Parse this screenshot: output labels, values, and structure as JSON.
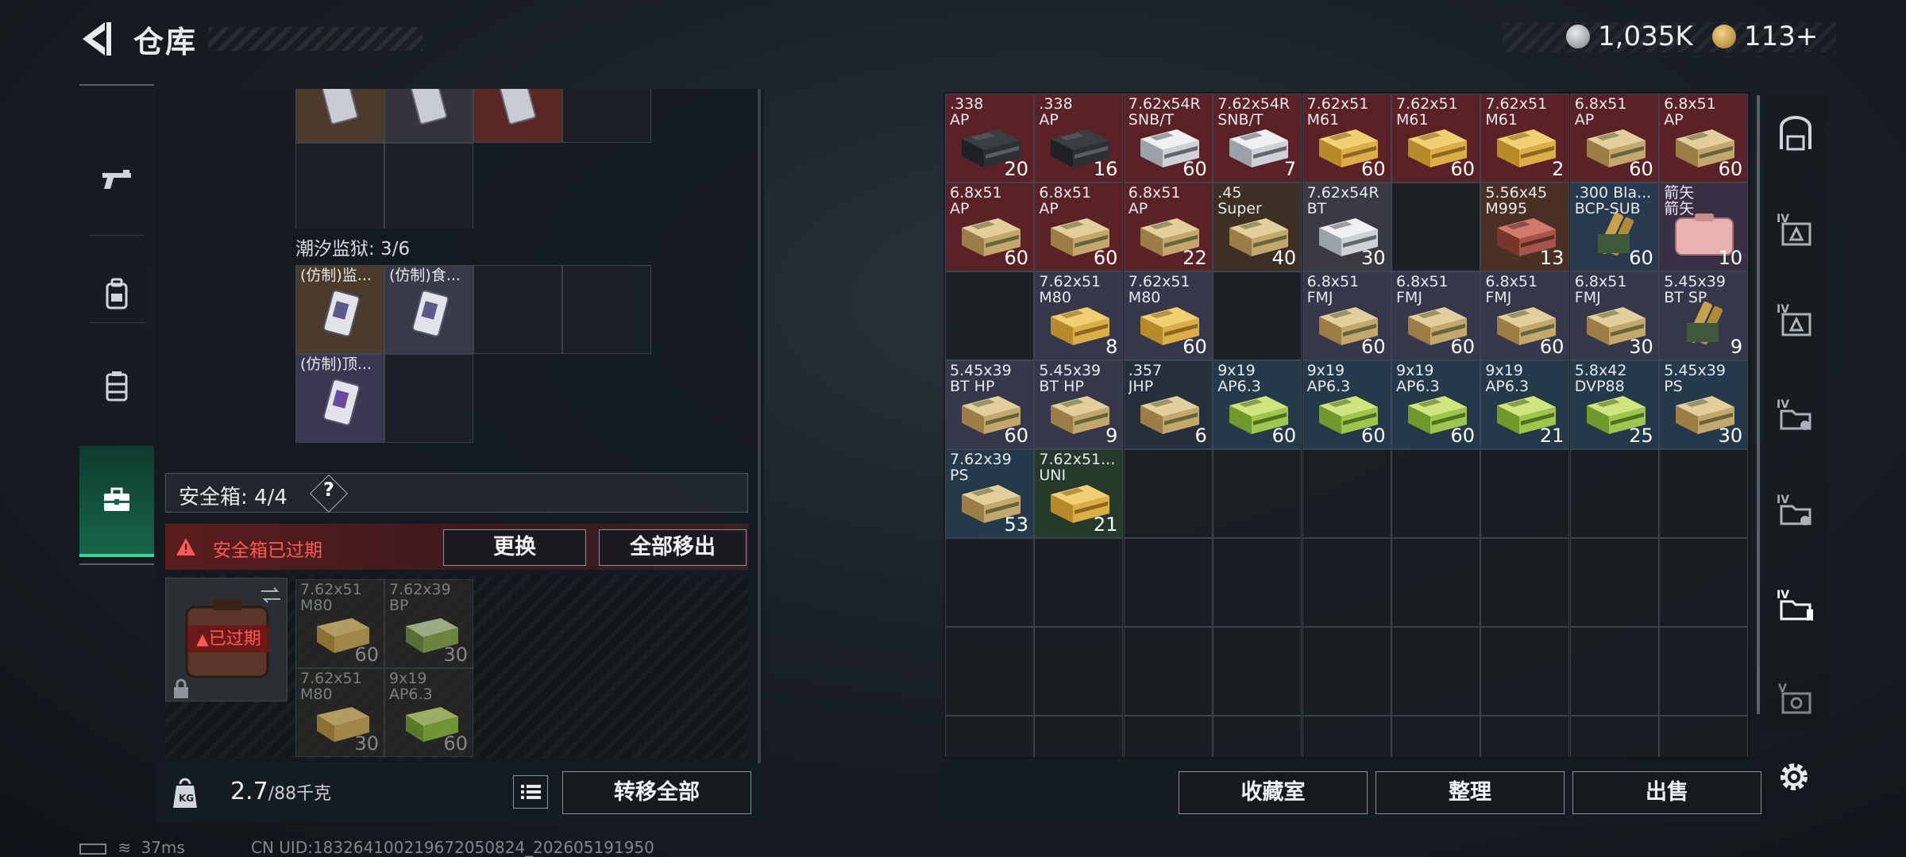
{
  "header": {
    "title": "仓库",
    "silver_amount": "1,035K",
    "gold_amount": "113+"
  },
  "left_nav": [
    {
      "name": "weapons",
      "icon": "gun-icon"
    },
    {
      "name": "armor",
      "icon": "backpack-icon"
    },
    {
      "name": "rig",
      "icon": "vest-icon"
    },
    {
      "name": "secure",
      "icon": "case-icon",
      "active": true
    }
  ],
  "left_panel": {
    "top_items": [
      {
        "label": "",
        "count": "",
        "color": "#4e3a2a",
        "art": "card"
      },
      {
        "label": "",
        "count": "",
        "color": "#35343d",
        "art": "card"
      },
      {
        "label": "",
        "count": "",
        "color": "#5a2626",
        "art": "card"
      }
    ],
    "prison_label": "潮汐监狱: 3/6",
    "prison_items": [
      {
        "label": "(仿制)监...",
        "count": "",
        "color": "#4a3b2a",
        "art": "card"
      },
      {
        "label": "(仿制)食...",
        "count": "",
        "color": "#383a48",
        "art": "card"
      },
      {
        "label": "(仿制)顶...",
        "count": "",
        "color": "#3a3750",
        "art": "card"
      }
    ],
    "safe_label": "安全箱: 4/4",
    "help": "?",
    "expired_banner": "安全箱已过期",
    "replace_button": "更换",
    "remove_all_button": "全部移出",
    "expired_tag": "已过期",
    "safe_items": [
      {
        "label": "7.62x51\nM80",
        "count": "60",
        "art": "box-tan"
      },
      {
        "label": "7.62x39\nBP",
        "count": "30",
        "art": "box-green"
      },
      {
        "label": "7.62x51\nM80",
        "count": "30",
        "art": "box-tan"
      },
      {
        "label": "9x19\nAP6.3",
        "count": "60",
        "art": "box-green"
      }
    ],
    "weight_value": "2.7",
    "weight_max": "/88千克",
    "transfer_button": "转移全部"
  },
  "stash_items": [
    {
      "label": ".338\nAP",
      "count": "20",
      "bg": "#5a2226",
      "art": "crate-dark"
    },
    {
      "label": ".338\nAP",
      "count": "16",
      "bg": "#5a2226",
      "art": "crate-dark"
    },
    {
      "label": "7.62x54R\nSNB/T",
      "count": "60",
      "bg": "#5a2226",
      "art": "box-white"
    },
    {
      "label": "7.62x54R\nSNB/T",
      "count": "7",
      "bg": "#5a2226",
      "art": "box-white"
    },
    {
      "label": "7.62x51\nM61",
      "count": "60",
      "bg": "#5a2226",
      "art": "box-yellow"
    },
    {
      "label": "7.62x51\nM61",
      "count": "60",
      "bg": "#5a2226",
      "art": "box-yellow"
    },
    {
      "label": "7.62x51\nM61",
      "count": "2",
      "bg": "#5a2226",
      "art": "box-yellow"
    },
    {
      "label": "6.8x51\nAP",
      "count": "60",
      "bg": "#5a2226",
      "art": "box-tan"
    },
    {
      "label": "6.8x51\nAP",
      "count": "60",
      "bg": "#5a2226",
      "art": "box-tan"
    },
    {
      "label": "6.8x51\nAP",
      "count": "60",
      "bg": "#5a2226",
      "art": "box-tan"
    },
    {
      "label": "6.8x51\nAP",
      "count": "60",
      "bg": "#5a2226",
      "art": "box-tan"
    },
    {
      "label": "6.8x51\nAP",
      "count": "22",
      "bg": "#5a2226",
      "art": "box-tan"
    },
    {
      "label": ".45\nSuper",
      "count": "40",
      "bg": "#3e2f25",
      "art": "box-tan"
    },
    {
      "label": "7.62x54R\nBT",
      "count": "30",
      "bg": "#3a3a44",
      "art": "box-white"
    },
    {
      "label": "",
      "count": "",
      "bg": "#1c2126",
      "art": "none"
    },
    {
      "label": "5.56x45\nM995",
      "count": "13",
      "bg": "#4a3024",
      "art": "box-red"
    },
    {
      "label": ".300 Bla...\nBCP-SUB",
      "count": "60",
      "bg": "#283a4d",
      "art": "cartridge"
    },
    {
      "label": "箭矢\n箭矢",
      "count": "10",
      "bg": "#3a3046",
      "art": "case-pink"
    },
    {
      "label": "",
      "count": "",
      "bg": "#1c2126",
      "art": "none"
    },
    {
      "label": "7.62x51\nM80",
      "count": "8",
      "bg": "#35384a",
      "art": "box-yellow"
    },
    {
      "label": "7.62x51\nM80",
      "count": "60",
      "bg": "#35384a",
      "art": "box-yellow"
    },
    {
      "label": "",
      "count": "",
      "bg": "#1c2126",
      "art": "none"
    },
    {
      "label": "6.8x51\nFMJ",
      "count": "60",
      "bg": "#35384a",
      "art": "box-tan"
    },
    {
      "label": "6.8x51\nFMJ",
      "count": "60",
      "bg": "#35384a",
      "art": "box-tan"
    },
    {
      "label": "6.8x51\nFMJ",
      "count": "60",
      "bg": "#35384a",
      "art": "box-tan"
    },
    {
      "label": "6.8x51\nFMJ",
      "count": "30",
      "bg": "#35384a",
      "art": "box-tan"
    },
    {
      "label": "5.45x39\nBT SP",
      "count": "9",
      "bg": "#35384a",
      "art": "cartridge"
    },
    {
      "label": "5.45x39\nBT HP",
      "count": "60",
      "bg": "#35384a",
      "art": "box-tan"
    },
    {
      "label": "5.45x39\nBT HP",
      "count": "9",
      "bg": "#35384a",
      "art": "box-tan"
    },
    {
      "label": ".357\nJHP",
      "count": "6",
      "bg": "#25303c",
      "art": "box-tan"
    },
    {
      "label": "9x19\nAP6.3",
      "count": "60",
      "bg": "#243a4a",
      "art": "box-green"
    },
    {
      "label": "9x19\nAP6.3",
      "count": "60",
      "bg": "#243a4a",
      "art": "box-green"
    },
    {
      "label": "9x19\nAP6.3",
      "count": "60",
      "bg": "#243a4a",
      "art": "box-green"
    },
    {
      "label": "9x19\nAP6.3",
      "count": "21",
      "bg": "#243a4a",
      "art": "box-green"
    },
    {
      "label": "5.8x42\nDVP88",
      "count": "25",
      "bg": "#243a4a",
      "art": "box-green"
    },
    {
      "label": "5.45x39\nPS",
      "count": "30",
      "bg": "#243a4a",
      "art": "box-tan"
    },
    {
      "label": "7.62x39\nPS",
      "count": "53",
      "bg": "#243a4a",
      "art": "box-tan"
    },
    {
      "label": "7.62x51...\nUNI",
      "count": "21",
      "bg": "#263a2c",
      "art": "box-yellow"
    }
  ],
  "bottom_right": {
    "collect_button": "收藏室",
    "sort_button": "整理",
    "sell_button": "出售"
  },
  "status": {
    "ping": "37ms",
    "uid": "CN UID:1832641002196720508​24_202605191950"
  },
  "right_nav": [
    {
      "icon": "shelf-icon"
    },
    {
      "icon": "iv-container-icon"
    },
    {
      "icon": "iv-container-icon"
    },
    {
      "icon": "iv-folder-icon"
    },
    {
      "icon": "iv-folder-icon"
    },
    {
      "icon": "iv-folder-icon"
    },
    {
      "icon": "v-container-icon"
    }
  ]
}
